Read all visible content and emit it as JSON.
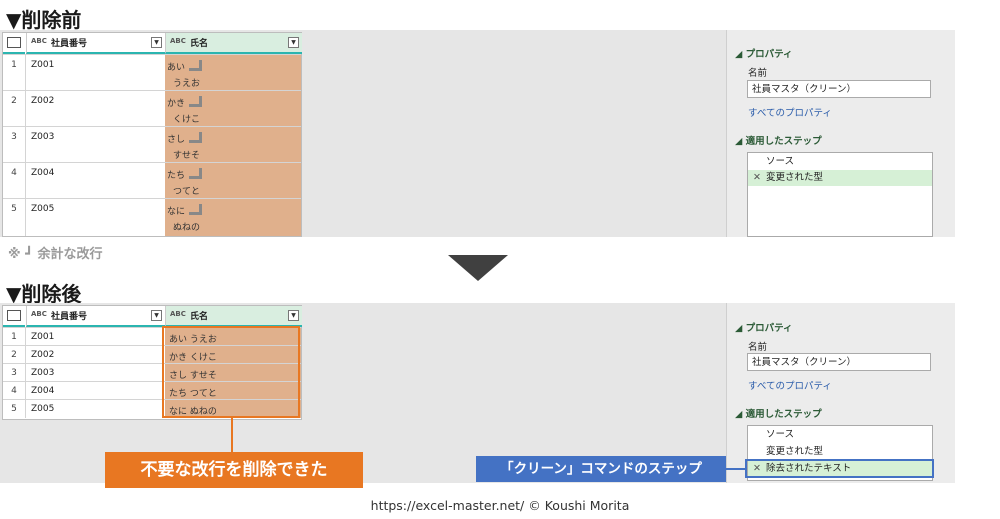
{
  "before": {
    "title": "▼削除前",
    "columns": [
      {
        "type_icon": "ABC",
        "label": "社員番号"
      },
      {
        "type_icon": "ABC",
        "label": "氏名"
      }
    ],
    "rows": [
      {
        "index": "1",
        "id": "Z001",
        "line1": "あい",
        "line2": "うえお"
      },
      {
        "index": "2",
        "id": "Z002",
        "line1": "かき",
        "line2": "くけこ"
      },
      {
        "index": "3",
        "id": "Z003",
        "line1": "さし",
        "line2": "すせそ"
      },
      {
        "index": "4",
        "id": "Z004",
        "line1": "たち",
        "line2": "つてと"
      },
      {
        "index": "5",
        "id": "Z005",
        "line1": "なに",
        "line2": "ぬねの"
      }
    ],
    "note": "※ ┛ 余計な改行"
  },
  "after": {
    "title": "▼削除後",
    "columns": [
      {
        "type_icon": "ABC",
        "label": "社員番号"
      },
      {
        "type_icon": "ABC",
        "label": "氏名"
      }
    ],
    "rows": [
      {
        "index": "1",
        "id": "Z001",
        "name": "あい うえお"
      },
      {
        "index": "2",
        "id": "Z002",
        "name": "かき くけこ"
      },
      {
        "index": "3",
        "id": "Z003",
        "name": "さし すせそ"
      },
      {
        "index": "4",
        "id": "Z004",
        "name": "たち つてと"
      },
      {
        "index": "5",
        "id": "Z005",
        "name": "なに ぬねの"
      }
    ]
  },
  "properties_panel": {
    "properties_heading": "◢ プロパティ",
    "name_label": "名前",
    "name_value": "社員マスタ（クリーン）",
    "all_properties_link": "すべてのプロパティ",
    "steps_heading": "◢ 適用したステップ",
    "steps_before": [
      {
        "label": "ソース",
        "x": ""
      },
      {
        "label": "変更された型",
        "x": "✕"
      }
    ],
    "steps_after": [
      {
        "label": "ソース",
        "x": ""
      },
      {
        "label": "変更された型",
        "x": ""
      },
      {
        "label": "除去されたテキスト",
        "x": "✕"
      }
    ]
  },
  "callouts": {
    "removed": "不要な改行を削除できた",
    "step": "「クリーン」コマンドのステップ"
  },
  "footer": "https://excel-master.net/  © Koushi Morita",
  "colors": {
    "accent_orange": "#e87722",
    "callout_blue": "#4472c4",
    "highlight_orange": "#e0b08c",
    "step_selected": "#d6f0d6"
  }
}
